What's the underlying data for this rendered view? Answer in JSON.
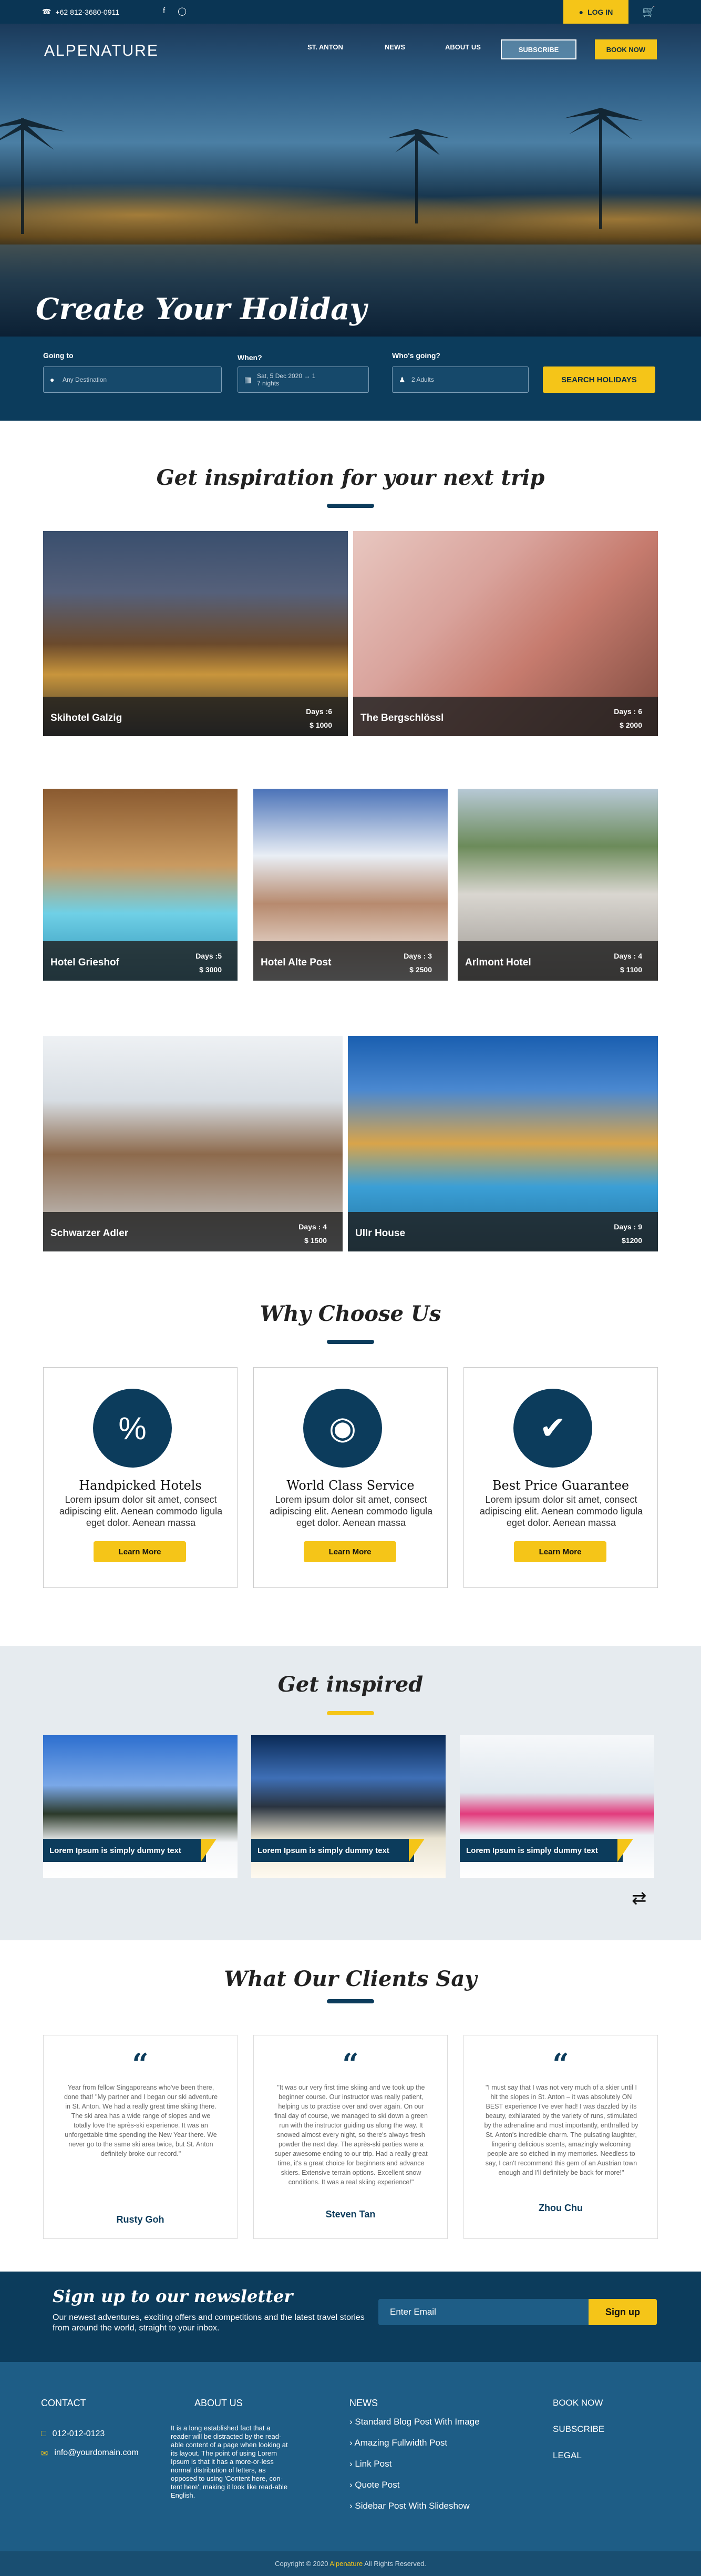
{
  "topbar": {
    "phone": "+62 812-3680-0911",
    "login": "LOG IN"
  },
  "header": {
    "logo": "ALPENATURE",
    "nav": [
      "ST. ANTON",
      "NEWS",
      "ABOUT US"
    ],
    "subscribe": "SUBSCRIBE",
    "book": "BOOK NOW"
  },
  "hero": {
    "title": "Create Your Holiday"
  },
  "search": {
    "going_label": "Going to",
    "going_placeholder": "Any Destination",
    "when_label": "When?",
    "when_value": "Sat, 5 Dec 2020 → 1",
    "when_nights": "7 nights",
    "who_label": "Who's going?",
    "who_value": "2 Adults",
    "button": "SEARCH HOLIDAYS"
  },
  "inspiration": {
    "title": "Get inspiration for your next trip",
    "cards": [
      {
        "name": "Skihotel Galzig",
        "days": "Days :6",
        "price": "$ 1000"
      },
      {
        "name": "The Bergschlössl",
        "days": "Days : 6",
        "price": "$ 2000"
      },
      {
        "name": "Hotel Grieshof",
        "days": "Days :5",
        "price": "$ 3000"
      },
      {
        "name": "Hotel Alte Post",
        "days": "Days : 3",
        "price": "$ 2500"
      },
      {
        "name": "Arlmont Hotel",
        "days": "Days : 4",
        "price": "$ 1100"
      },
      {
        "name": "Schwarzer Adler",
        "days": "Days : 4",
        "price": "$ 1500"
      },
      {
        "name": "Ullr House",
        "days": "Days : 9",
        "price": "$1200"
      }
    ]
  },
  "why": {
    "title": "Why Choose Us",
    "items": [
      {
        "title": "Handpicked Hotels",
        "desc": "Lorem ipsum dolor sit amet, consect adipiscing elit. Aenean commodo ligula eget dolor. Aenean massa",
        "button": "Learn More"
      },
      {
        "title": "World Class Service",
        "desc": "Lorem ipsum dolor sit amet, consect adipiscing elit. Aenean commodo ligula eget dolor. Aenean massa",
        "button": "Learn More"
      },
      {
        "title": "Best Price Guarantee",
        "desc": "Lorem ipsum dolor sit amet, consect adipiscing elit. Aenean commodo ligula eget dolor. Aenean massa",
        "button": "Learn More"
      }
    ]
  },
  "inspired": {
    "title": "Get inspired",
    "slides": [
      "Lorem Ipsum is simply dummy text",
      "Lorem Ipsum is simply dummy text",
      "Lorem Ipsum is simply dummy text"
    ]
  },
  "clients": {
    "title": "What Our Clients Say",
    "items": [
      {
        "text": "Year from fellow Singaporeans who've been there, done that! \"My partner and I began our ski adventure in St. Anton. We had a really great time skiing there. The ski area has a wide range of slopes and we totally love the après-ski experience. It was an unforgettable time spending the New Year there. We never go to the same ski area twice, but St. Anton definitely broke our record.\"",
        "name": "Rusty Goh"
      },
      {
        "text": "\"It was our very first time skiing and we took up the beginner course. Our instructor was really patient, helping us to practise over and over again. On our final day of course, we managed to ski down a green run with the instructor guiding us along the way. It snowed almost every night, so there's always fresh powder the next day. The après-ski parties were a super awesome ending to our trip. Had a really great time, it's a great choice for beginners and advance skiers. Extensive terrain options. Excellent snow conditions. It was a real skiing experience!\"",
        "name": "Steven Tan"
      },
      {
        "text": "\"I must say that I was not very much of a skier until I hit the slopes in St. Anton – it was absolutely ON BEST experience I've ever had! I was dazzled by its beauty, exhilarated by the variety of runs, stimulated by the adrenaline and most importantly, enthralled by St. Anton's incredible charm. The pulsating laughter, lingering delicious scents, amazingly welcoming people are so etched in my memories. Needless to say, I can't recommend this gem of an Austrian town enough and I'll definitely be back for more!\"",
        "name": "Zhou Chu"
      }
    ]
  },
  "newsletter": {
    "title": "Sign up to our newsletter",
    "desc": "Our newest adventures, exciting offers and competitions and the latest travel stories from around the world, straight to your inbox.",
    "placeholder": "Enter Email",
    "button": "Sign up"
  },
  "footer": {
    "contact_title": "CONTACT",
    "phone": "012-012-0123",
    "email": "info@yourdomain.com",
    "about_title": "ABOUT US",
    "about_text": "It is a long established fact that a reader will be distracted by the read-able content of a page when looking at its layout. The point of using Lorem Ipsum is that it has a more-or-less normal distribution of letters, as opposed to using 'Content here, con-tent here', making it look like read-able English.",
    "news_title": "NEWS",
    "news": [
      "Standard Blog Post With Image",
      "Amazing Fullwidth Post",
      "Link Post",
      "Quote Post",
      "Sidebar Post With Slideshow"
    ],
    "links": [
      "BOOK NOW",
      "SUBSCRIBE",
      "LEGAL"
    ],
    "copyright": "Copyright © 2020",
    "brand": "Alpenature",
    "rights": "All Rights Reserved."
  },
  "colors": {
    "navy": "#0c3c5c",
    "accent": "#f5c518",
    "footer": "#1e5d86"
  }
}
